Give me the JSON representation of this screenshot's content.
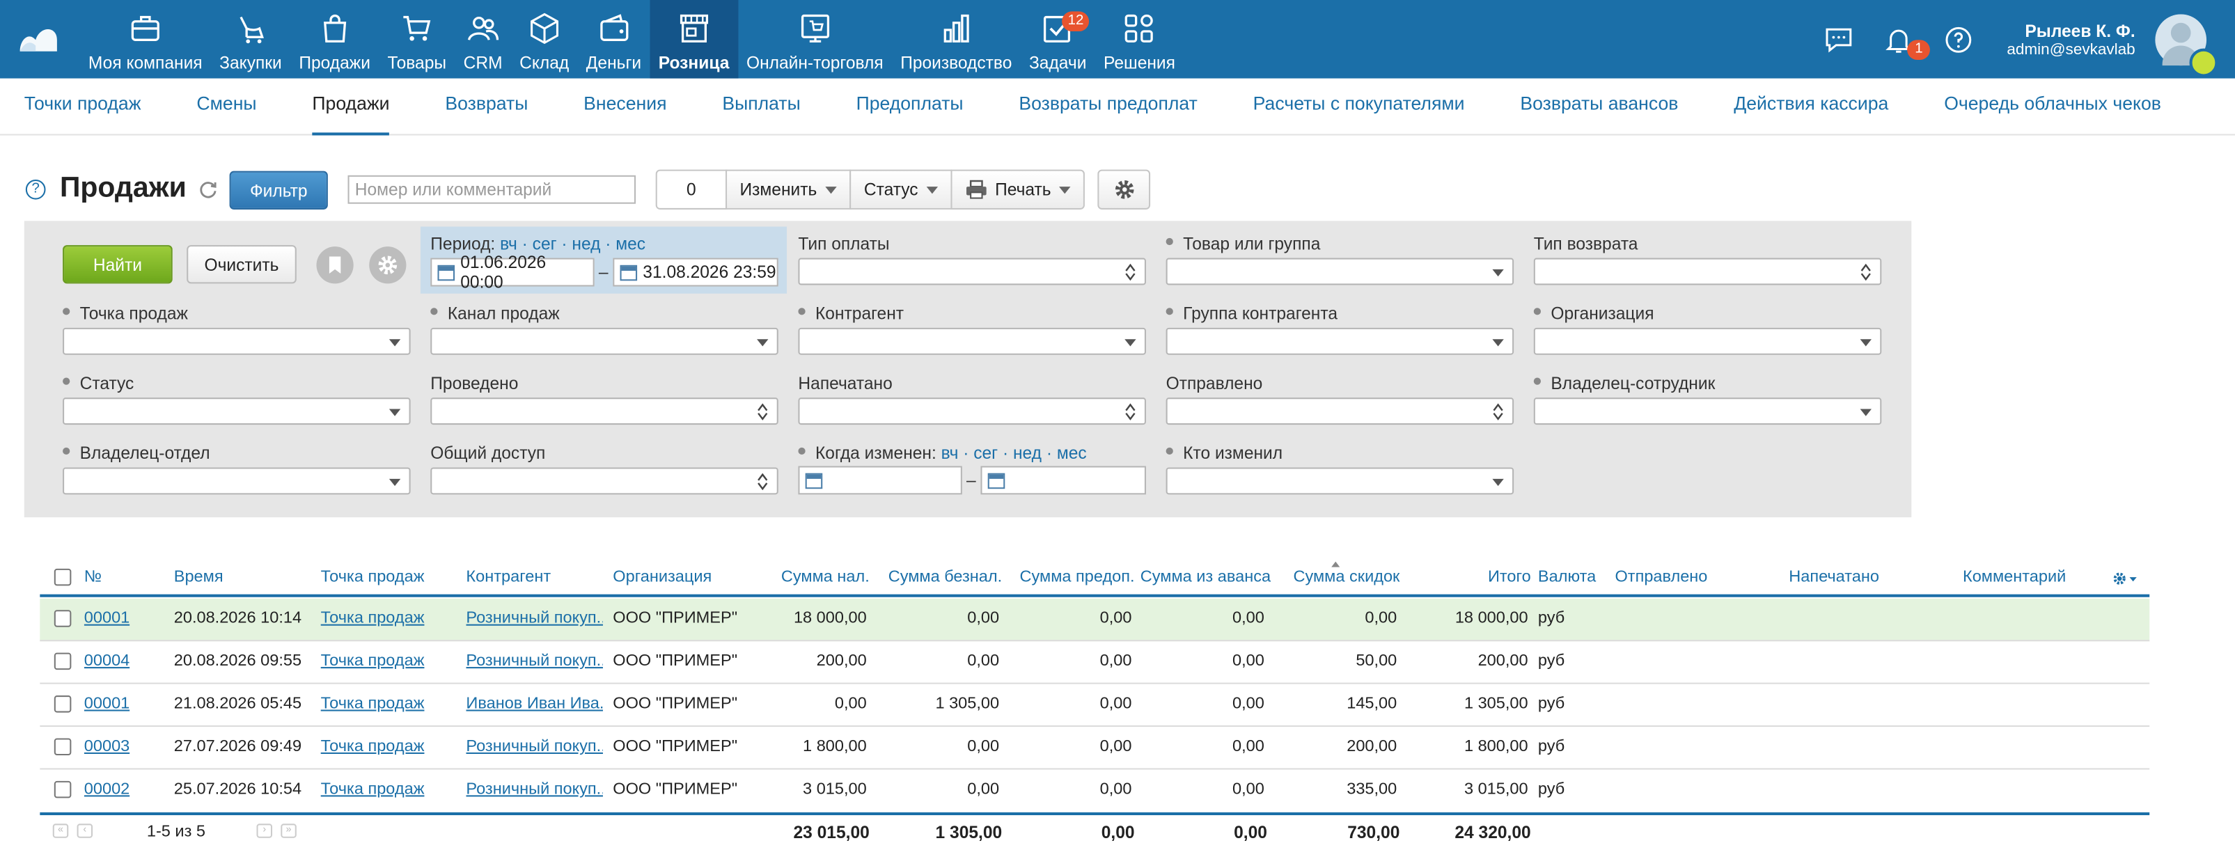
{
  "topnav": [
    {
      "label": "Моя компания",
      "icon": "briefcase-icon"
    },
    {
      "label": "Закупки",
      "icon": "purchases-icon"
    },
    {
      "label": "Продажи",
      "icon": "shopping-bag-icon"
    },
    {
      "label": "Товары",
      "icon": "cart-icon"
    },
    {
      "label": "CRM",
      "icon": "people-icon"
    },
    {
      "label": "Склад",
      "icon": "box-icon"
    },
    {
      "label": "Деньги",
      "icon": "wallet-icon"
    },
    {
      "label": "Розница",
      "icon": "store-icon",
      "active": true
    },
    {
      "label": "Онлайн-торговля",
      "icon": "online-store-icon"
    },
    {
      "label": "Производство",
      "icon": "bar-chart-icon"
    },
    {
      "label": "Задачи",
      "icon": "task-check-icon",
      "badge": "12"
    },
    {
      "label": "Решения",
      "icon": "apps-grid-icon"
    }
  ],
  "topright": {
    "notif_badge": "1",
    "user_name": "Рылеев К. Ф.",
    "user_email": "admin@sevkavlab"
  },
  "subnav": [
    {
      "label": "Точки продаж"
    },
    {
      "label": "Смены"
    },
    {
      "label": "Продажи",
      "active": true
    },
    {
      "label": "Возвраты"
    },
    {
      "label": "Внесения"
    },
    {
      "label": "Выплаты"
    },
    {
      "label": "Предоплаты"
    },
    {
      "label": "Возвраты предоплат"
    },
    {
      "label": "Расчеты с покупателями"
    },
    {
      "label": "Возвраты авансов"
    },
    {
      "label": "Действия кассира"
    },
    {
      "label": "Очередь облачных чеков"
    }
  ],
  "toolbar": {
    "help": "?",
    "title": "Продажи",
    "filter_label": "Фильтр",
    "search_placeholder": "Номер или комментарий",
    "count": "0",
    "change_label": "Изменить",
    "status_label": "Статус",
    "print_label": "Печать"
  },
  "filter": {
    "find_label": "Найти",
    "clear_label": "Очистить",
    "period_label": "Период:",
    "quick_period": "вч · сег · нед · мес",
    "date_from": "01.06.2026 00:00",
    "date_to": "31.08.2026 23:59",
    "dash": "–",
    "payment_type": "Тип оплаты",
    "product_group": "Товар или группа",
    "return_type": "Тип возврата",
    "point_of_sale": "Точка продаж",
    "sales_channel": "Канал продаж",
    "counterparty": "Контрагент",
    "counterparty_group": "Группа контрагента",
    "organization": "Организация",
    "status": "Статус",
    "posted": "Проведено",
    "printed": "Напечатано",
    "sent": "Отправлено",
    "owner_employee": "Владелец-сотрудник",
    "owner_department": "Владелец-отдел",
    "shared_access": "Общий доступ",
    "changed_when": "Когда изменен:",
    "quick_changed": "вч · сег · нед · мес",
    "changed_by": "Кто изменил"
  },
  "table": {
    "headers": {
      "num": "№",
      "time": "Время",
      "pos": "Точка продаж",
      "counterparty": "Контрагент",
      "org": "Организация",
      "cash": "Сумма нал.",
      "cashless": "Сумма безнал.",
      "prepaid": "Сумма предоп.",
      "advance": "Сумма из аванса",
      "discount": "Сумма скидок",
      "total": "Итого",
      "currency": "Валюта",
      "sent": "Отправлено",
      "printed": "Напечатано",
      "comment": "Комментарий"
    },
    "rows": [
      {
        "num": "00001",
        "time": "20.08.2026 10:14",
        "pos": "Точка продаж",
        "counterparty": "Розничный покуп...",
        "org": "ООО \"ПРИМЕР\"",
        "cash": "18 000,00",
        "cashless": "0,00",
        "prepaid": "0,00",
        "advance": "0,00",
        "discount": "0,00",
        "total": "18 000,00",
        "currency": "руб"
      },
      {
        "num": "00004",
        "time": "20.08.2026 09:55",
        "pos": "Точка продаж",
        "counterparty": "Розничный покуп...",
        "org": "ООО \"ПРИМЕР\"",
        "cash": "200,00",
        "cashless": "0,00",
        "prepaid": "0,00",
        "advance": "0,00",
        "discount": "50,00",
        "total": "200,00",
        "currency": "руб"
      },
      {
        "num": "00001",
        "time": "21.08.2026 05:45",
        "pos": "Точка продаж",
        "counterparty": "Иванов Иван Ива...",
        "org": "ООО \"ПРИМЕР\"",
        "cash": "0,00",
        "cashless": "1 305,00",
        "prepaid": "0,00",
        "advance": "0,00",
        "discount": "145,00",
        "total": "1 305,00",
        "currency": "руб"
      },
      {
        "num": "00003",
        "time": "27.07.2026 09:49",
        "pos": "Точка продаж",
        "counterparty": "Розничный покуп...",
        "org": "ООО \"ПРИМЕР\"",
        "cash": "1 800,00",
        "cashless": "0,00",
        "prepaid": "0,00",
        "advance": "0,00",
        "discount": "200,00",
        "total": "1 800,00",
        "currency": "руб"
      },
      {
        "num": "00002",
        "time": "25.07.2026 10:54",
        "pos": "Точка продаж",
        "counterparty": "Розничный покуп...",
        "org": "ООО \"ПРИМЕР\"",
        "cash": "3 015,00",
        "cashless": "0,00",
        "prepaid": "0,00",
        "advance": "0,00",
        "discount": "335,00",
        "total": "3 015,00",
        "currency": "руб"
      }
    ],
    "footer": {
      "page_info": "1-5 из 5",
      "cash": "23 015,00",
      "cashless": "1 305,00",
      "prepaid": "0,00",
      "advance": "0,00",
      "discount": "730,00",
      "total": "24 320,00"
    }
  },
  "colors": {
    "topbar": "#1b6fa8",
    "active_tab": "#14558a",
    "link": "#1b6fa8",
    "find_button": "#7db52a",
    "selected_row": "#e4f3de",
    "badge": "#e8542f"
  }
}
